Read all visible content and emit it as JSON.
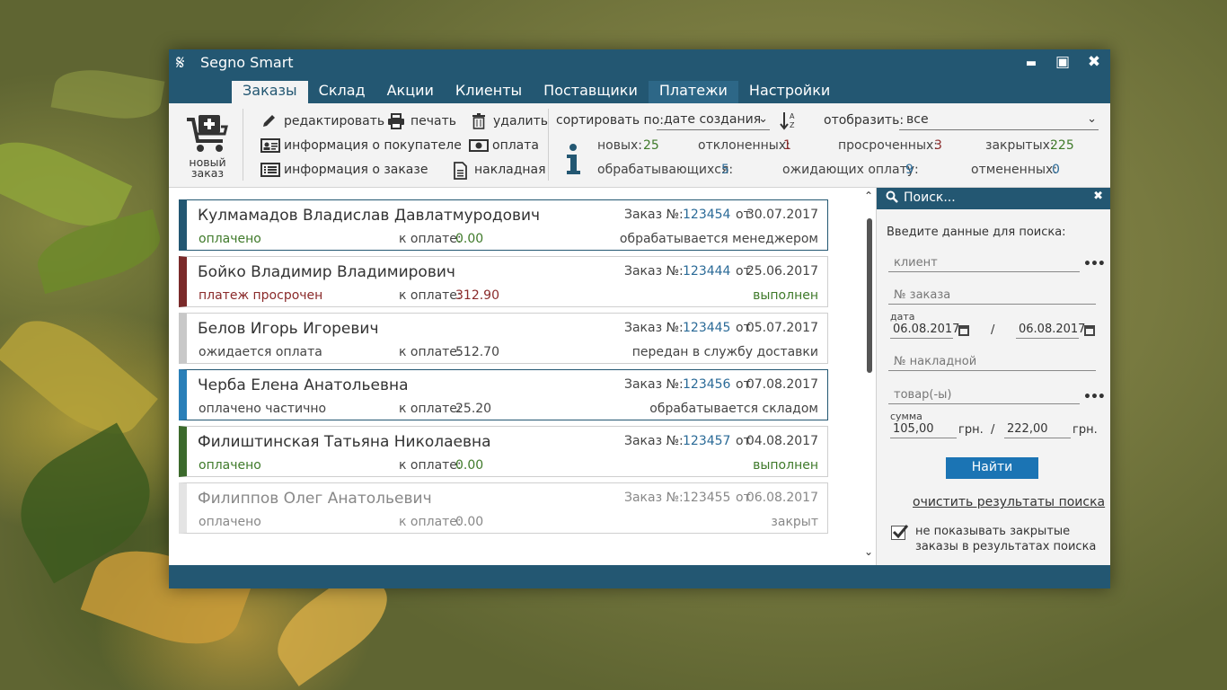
{
  "window": {
    "logo": "𝄋",
    "title": "Segno Smart",
    "minimize": "▬",
    "maximize": "▣",
    "close": "✖"
  },
  "tabs": [
    "Заказы",
    "Склад",
    "Акции",
    "Клиенты",
    "Поставщики",
    "Платежи",
    "Настройки"
  ],
  "toolbar": {
    "new_order": "новый\nзаказ",
    "edit": "редактировать",
    "print": "печать",
    "delete": "удалить",
    "buyer_info": "информация о покупателе",
    "payment": "оплата",
    "order_info": "информация о заказе",
    "invoice": "накладная",
    "sort_label": "сортировать по:",
    "sort_value": "дате создания",
    "sort_chevron": "⌄",
    "show_label": "отобразить:",
    "show_value": "все",
    "show_chevron": "⌄"
  },
  "stats": {
    "new_label": "новых:",
    "new_val": "25",
    "rejected_label": "отклоненных:",
    "rejected_val": "1",
    "overdue_label": "просроченных:",
    "overdue_val": "3",
    "closed_label": "закрытых:",
    "closed_val": "225",
    "processing_label": "обрабатывающихся:",
    "processing_val": "5",
    "awaiting_label": "ожидающих оплату:",
    "awaiting_val": "9",
    "cancelled_label": "отмененных:",
    "cancelled_val": "0"
  },
  "orders": [
    {
      "name": "Кулмамадов Владислав Давлатмуродович",
      "order_label": "Заказ №:",
      "number": "123454",
      "from": "от",
      "date": "30.07.2017",
      "status": "оплачено",
      "pay_label": "к оплате:",
      "pay": "0.00",
      "state": "обрабатывается менеджером"
    },
    {
      "name": "Бойко Владимир Владимирович",
      "order_label": "Заказ №:",
      "number": "123444",
      "from": "от",
      "date": "25.06.2017",
      "status": "платеж просрочен",
      "pay_label": "к оплате:",
      "pay": "312.90",
      "state": "выполнен"
    },
    {
      "name": "Белов Игорь Игоревич",
      "order_label": "Заказ №:",
      "number": "123445",
      "from": "от",
      "date": "05.07.2017",
      "status": "ожидается оплата",
      "pay_label": "к оплате:",
      "pay": "512.70",
      "state": "передан в службу доставки"
    },
    {
      "name": "Черба Елена Анатольевна",
      "order_label": "Заказ №:",
      "number": "123456",
      "from": "от",
      "date": "07.08.2017",
      "status": "оплачено частично",
      "pay_label": "к оплате:",
      "pay": "25.20",
      "state": "обрабатывается складом"
    },
    {
      "name": "Филиштинская Татьяна Николаевна",
      "order_label": "Заказ №:",
      "number": "123457",
      "from": "от",
      "date": "04.08.2017",
      "status": "оплачено",
      "pay_label": "к оплате:",
      "pay": "0.00",
      "state": "выполнен"
    },
    {
      "name": "Филиппов Олег Анатольевич",
      "order_label": "Заказ №:",
      "number": "123455",
      "from": "от",
      "date": "06.08.2017",
      "status": "оплачено",
      "pay_label": "к оплате:",
      "pay": "0.00",
      "state": "закрыт"
    }
  ],
  "colors": {
    "accent": "#235772",
    "paid_green": "#3f7a2a",
    "overdue_red": "#8a2a2a",
    "link_blue": "#2a6a97",
    "strip_blue": "#235772",
    "strip_red": "#7a2a2a",
    "strip_gray": "#c8c8c8",
    "strip_lightblue": "#2a7fb8",
    "strip_green": "#3c6a2c",
    "strip_light": "#e4e4e4"
  },
  "search": {
    "title": "Поиск...",
    "close": "✖",
    "prompt": "Введите данные для поиска:",
    "client_placeholder": "клиент",
    "dots": "•••",
    "order_placeholder": "№ заказа",
    "date_label": "дата",
    "date_from": "06.08.2017",
    "date_sep": "/",
    "date_to": "06.08.2017",
    "invoice_placeholder": "№ накладной",
    "goods_placeholder": "товар(-ы)",
    "sum_label": "сумма",
    "sum_from": "105,00",
    "sum_to": "222,00",
    "currency": "грн.",
    "find_button": "Найти",
    "clear_link": "очистить результаты поиска",
    "hide_closed_checked": true,
    "hide_closed_label": "не показывать закрытые заказы в результатах поиска"
  },
  "scroll": {
    "up": "⌃",
    "down": "⌄"
  }
}
